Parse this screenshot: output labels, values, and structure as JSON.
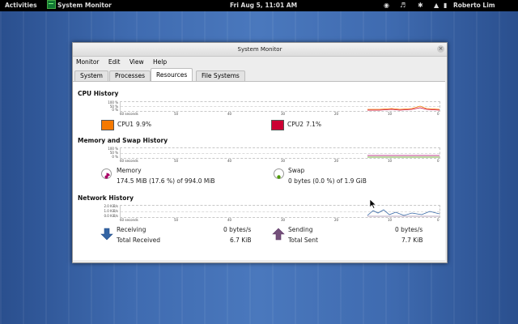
{
  "topbar": {
    "activities": "Activities",
    "app_name": "System Monitor",
    "clock": "Fri Aug  5, 11:01 AM",
    "user": "Roberto Lim"
  },
  "window": {
    "title": "System Monitor",
    "menu": [
      "Monitor",
      "Edit",
      "View",
      "Help"
    ],
    "tabs": [
      "System",
      "Processes",
      "Resources",
      "File Systems"
    ],
    "active_tab": "Resources"
  },
  "cpu": {
    "heading": "CPU History",
    "y_ticks": [
      "100 %",
      "50 %",
      "0 %"
    ],
    "x_ticks": [
      "60 seconds",
      "50",
      "40",
      "30",
      "20",
      "10",
      "0"
    ],
    "cpu1_label": "CPU1",
    "cpu1_value": "9.9%",
    "cpu1_color": "#f57900",
    "cpu2_label": "CPU2",
    "cpu2_value": "7.1%",
    "cpu2_color": "#cc0033"
  },
  "memory": {
    "heading": "Memory and Swap History",
    "y_ticks": [
      "100 %",
      "50 %",
      "0 %"
    ],
    "x_ticks": [
      "60 seconds",
      "50",
      "40",
      "30",
      "20",
      "10",
      "0"
    ],
    "memory_label": "Memory",
    "memory_value": "174.5 MiB (17.6 %) of 994.0 MiB",
    "memory_color": "#aa0066",
    "swap_label": "Swap",
    "swap_value": "0 bytes (0.0 %) of 1.9 GiB",
    "swap_color": "#4e9a06"
  },
  "network": {
    "heading": "Network History",
    "y_ticks": [
      "2.0 KiB/s",
      "1.0 KiB/s",
      "0.0 KiB/s"
    ],
    "x_ticks": [
      "60 seconds",
      "50",
      "40",
      "30",
      "20",
      "10",
      "0"
    ],
    "receiving_label": "Receiving",
    "receiving_value": "0 bytes/s",
    "total_received_label": "Total Received",
    "total_received_value": "6.7 KiB",
    "sending_label": "Sending",
    "sending_value": "0 bytes/s",
    "total_sent_label": "Total Sent",
    "total_sent_value": "7.7 KiB",
    "receiving_color": "#3465a4",
    "sending_color": "#75507b"
  }
}
